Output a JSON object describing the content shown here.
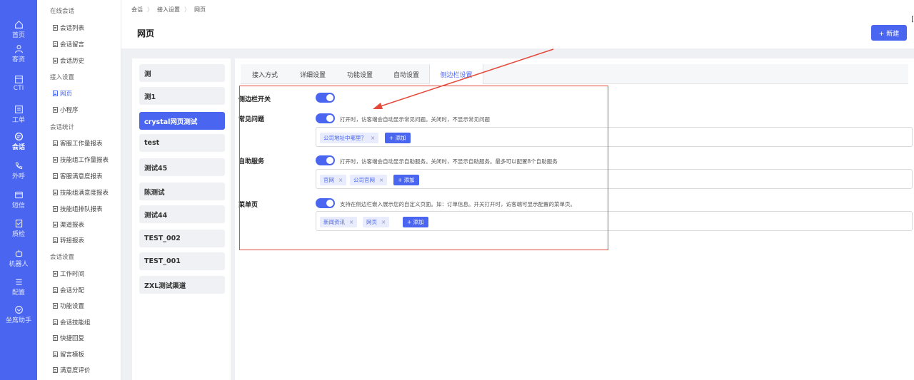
{
  "rail": [
    {
      "icon": "home-icon",
      "label": "首页"
    },
    {
      "icon": "customer-icon",
      "label": "客资"
    },
    {
      "icon": "cti-icon",
      "label": "CTI"
    },
    {
      "icon": "ticket-icon",
      "label": "工单"
    },
    {
      "icon": "chat-icon",
      "label": "会话"
    },
    {
      "icon": "phone-icon",
      "label": "外呼"
    },
    {
      "icon": "sms-icon",
      "label": "短信"
    },
    {
      "icon": "qc-icon",
      "label": "质检"
    },
    {
      "icon": "robot-icon",
      "label": "机器人"
    },
    {
      "icon": "settings-icon",
      "label": "配置"
    },
    {
      "icon": "assistant-icon",
      "label": "坐席助手"
    }
  ],
  "nav": {
    "items": [
      {
        "type": "group",
        "label": "在线会话"
      },
      {
        "type": "item",
        "label": "会话列表"
      },
      {
        "type": "item",
        "label": "会话留言"
      },
      {
        "type": "item",
        "label": "会话历史"
      },
      {
        "type": "group",
        "label": "接入设置"
      },
      {
        "type": "item",
        "label": "网页",
        "active": true
      },
      {
        "type": "item",
        "label": "小程序"
      },
      {
        "type": "group",
        "label": "会话统计"
      },
      {
        "type": "item",
        "label": "客服工作量报表"
      },
      {
        "type": "item",
        "label": "技能组工作量报表"
      },
      {
        "type": "item",
        "label": "客服满意度报表"
      },
      {
        "type": "item",
        "label": "技能组满意度报表"
      },
      {
        "type": "item",
        "label": "技能组排队报表"
      },
      {
        "type": "item",
        "label": "渠道报表"
      },
      {
        "type": "item",
        "label": "转接报表"
      },
      {
        "type": "group",
        "label": "会话设置"
      },
      {
        "type": "item",
        "label": "工作时间"
      },
      {
        "type": "item",
        "label": "会话分配"
      },
      {
        "type": "item",
        "label": "功能设置"
      },
      {
        "type": "item",
        "label": "会话技能组"
      },
      {
        "type": "item",
        "label": "快捷回复"
      },
      {
        "type": "item",
        "label": "留言模板"
      },
      {
        "type": "item",
        "label": "满意度评价"
      }
    ]
  },
  "header": {
    "breadcrumb": [
      "会话",
      "接入设置",
      "网页"
    ],
    "title": "网页",
    "new_button": "+ 新建"
  },
  "channels": [
    "测",
    "测1",
    "crystal网页测试",
    "test",
    "测试45",
    "陈测试",
    "测试44",
    "TEST_002",
    "TEST_001",
    "ZXL测试渠道"
  ],
  "tabs": [
    "接入方式",
    "详细设置",
    "功能设置",
    "自动设置",
    "侧边栏设置"
  ],
  "sidebar_settings": {
    "switch_label": "侧边栏开关",
    "faq": {
      "label": "常见问题",
      "hint": "打开时，访客端会自动显示常见问题。关闭时，不显示常见问题",
      "tags": [
        "公司地址中哪里？"
      ],
      "add": "+ 添加"
    },
    "self_service": {
      "label": "自助服务",
      "hint": "打开时，访客端会自动显示自助服务。关闭时，不显示自助服务。最多可以配置8个自助服务",
      "tags": [
        "官网",
        "公司官网"
      ],
      "add": "+ 添加"
    },
    "menu_page": {
      "label": "菜单页",
      "hint": "支持在侧边栏嵌入展示您的自定义页面。如：订单信息。开关打开时，访客端可显示配置的菜单页。",
      "tags": [
        "新闻资讯",
        "网页"
      ],
      "add": "+ 添加"
    }
  },
  "colors": {
    "accent": "#4a66f0",
    "annotation": "#e34a3c"
  }
}
